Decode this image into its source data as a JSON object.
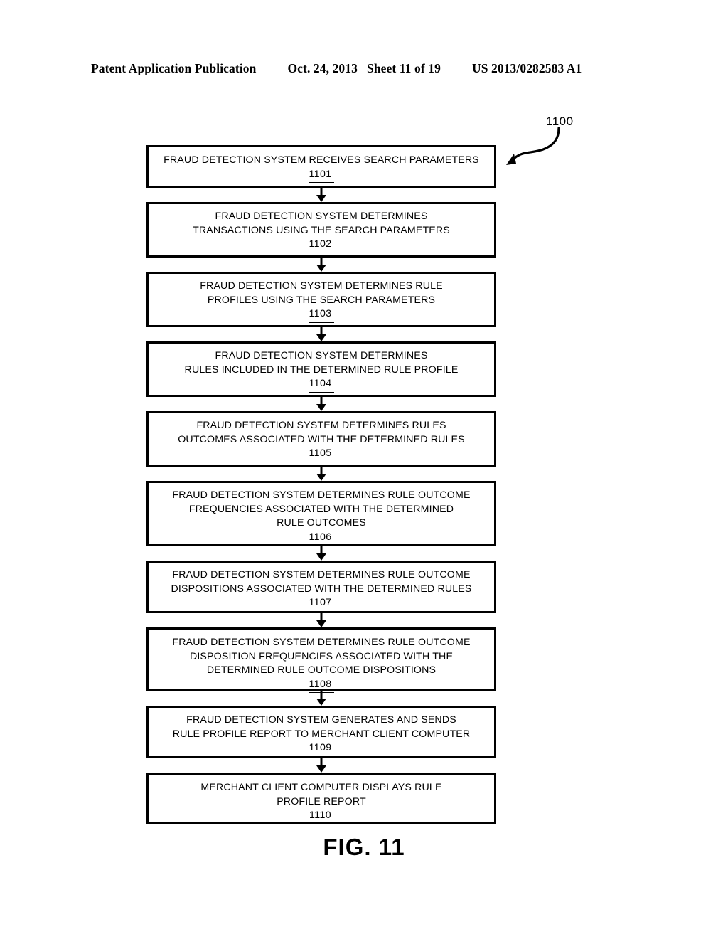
{
  "header": {
    "publication": "Patent Application Publication",
    "date": "Oct. 24, 2013",
    "sheet": "Sheet 11 of 19",
    "patent_number": "US 2013/0282583 A1"
  },
  "figure": {
    "caption": "FIG. 11",
    "diagram_reference": "1100"
  },
  "flowchart": {
    "steps": [
      {
        "lines": [
          "FRAUD DETECTION SYSTEM RECEIVES SEARCH PARAMETERS"
        ],
        "ref": "1101"
      },
      {
        "lines": [
          "FRAUD DETECTION SYSTEM DETERMINES",
          "TRANSACTIONS USING THE SEARCH PARAMETERS"
        ],
        "ref": "1102"
      },
      {
        "lines": [
          "FRAUD DETECTION SYSTEM DETERMINES RULE",
          "PROFILES USING THE SEARCH PARAMETERS"
        ],
        "ref": "1103"
      },
      {
        "lines": [
          "FRAUD DETECTION SYSTEM DETERMINES",
          "RULES INCLUDED IN THE DETERMINED RULE PROFILE"
        ],
        "ref": "1104"
      },
      {
        "lines": [
          "FRAUD DETECTION SYSTEM DETERMINES RULES",
          "OUTCOMES ASSOCIATED WITH THE DETERMINED RULES"
        ],
        "ref": "1105"
      },
      {
        "lines": [
          "FRAUD DETECTION SYSTEM DETERMINES RULE OUTCOME",
          "FREQUENCIES ASSOCIATED WITH THE DETERMINED",
          "RULE OUTCOMES"
        ],
        "ref": "1106"
      },
      {
        "lines": [
          "FRAUD DETECTION SYSTEM DETERMINES RULE OUTCOME",
          "DISPOSITIONS ASSOCIATED WITH THE DETERMINED RULES"
        ],
        "ref": "1107"
      },
      {
        "lines": [
          "FRAUD DETECTION SYSTEM DETERMINES RULE OUTCOME",
          "DISPOSITION FREQUENCIES ASSOCIATED WITH THE",
          "DETERMINED RULE OUTCOME DISPOSITIONS"
        ],
        "ref": "1108"
      },
      {
        "lines": [
          "FRAUD DETECTION SYSTEM GENERATES AND SENDS",
          "RULE PROFILE REPORT TO MERCHANT CLIENT COMPUTER"
        ],
        "ref": "1109"
      },
      {
        "lines": [
          "MERCHANT CLIENT COMPUTER DISPLAYS RULE",
          "PROFILE REPORT"
        ],
        "ref": "1110"
      }
    ]
  }
}
